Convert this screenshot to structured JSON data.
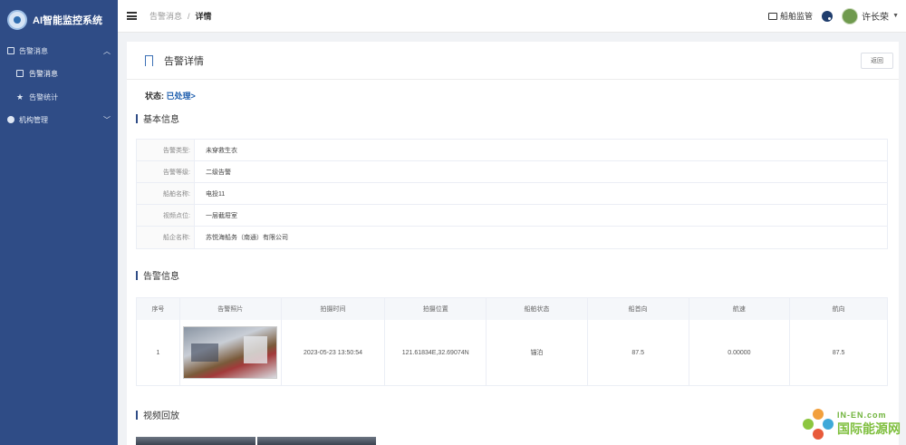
{
  "sidebar": {
    "title": "AI智能监控系统",
    "groups": [
      {
        "label": "告警消息",
        "items": [
          {
            "label": "告警消息"
          },
          {
            "label": "告警统计"
          }
        ]
      },
      {
        "label": "机构管理"
      }
    ]
  },
  "topbar": {
    "breadcrumb_parent": "告警消息",
    "breadcrumb_sep": "/",
    "breadcrumb_current": "详情",
    "monitor_label": "船舶监管",
    "user_name": "许长荣"
  },
  "detail": {
    "title": "告警详情",
    "back_label": "返回",
    "status_label": "状态:",
    "status_value": "已处理>"
  },
  "basic_info": {
    "section_title": "基本信息",
    "rows": [
      {
        "label": "告警类型:",
        "value": "未穿救生衣"
      },
      {
        "label": "告警等级:",
        "value": "二级告警"
      },
      {
        "label": "船舶名称:",
        "value": "电投11"
      },
      {
        "label": "视频点位:",
        "value": "一层截屉室"
      },
      {
        "label": "船企名称:",
        "value": "苏悦海船务（南通）有限公司"
      }
    ]
  },
  "alarm_info": {
    "section_title": "告警信息",
    "headers": [
      "序号",
      "告警照片",
      "拍摄时间",
      "拍摄位置",
      "船舶状态",
      "船首向",
      "航速",
      "航向"
    ],
    "row": {
      "index": "1",
      "time": "2023-05-23 13:50:54",
      "position": "121.61834E,32.69074N",
      "ship_status": "锚泊",
      "heading": "87.5",
      "speed": "0.00000",
      "course": "87.5"
    }
  },
  "video": {
    "section_title": "视频回放"
  },
  "watermark": {
    "en": "IN-EN.com",
    "cn": "国际能源网"
  }
}
